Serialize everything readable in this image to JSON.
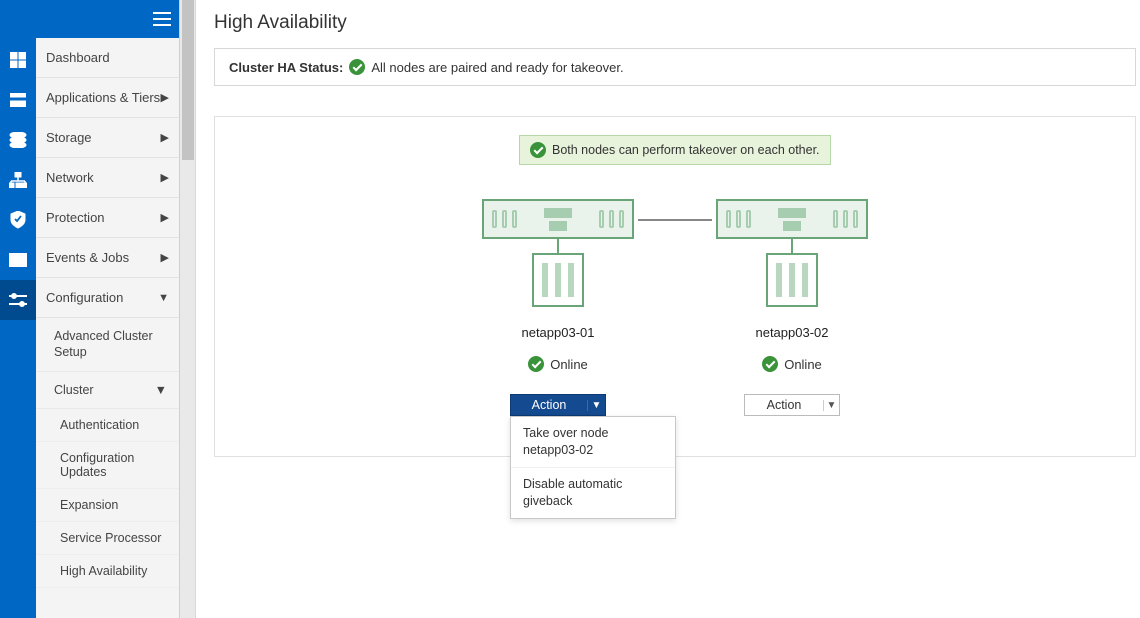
{
  "page_title": "High Availability",
  "sidebar": {
    "items": [
      {
        "label": "Dashboard",
        "expandable": false
      },
      {
        "label": "Applications & Tiers",
        "expandable": true
      },
      {
        "label": "Storage",
        "expandable": true
      },
      {
        "label": "Network",
        "expandable": true
      },
      {
        "label": "Protection",
        "expandable": true
      },
      {
        "label": "Events & Jobs",
        "expandable": true
      },
      {
        "label": "Configuration",
        "expandable": true,
        "expanded": true
      }
    ],
    "config_children": [
      {
        "label": "Advanced Cluster Setup"
      },
      {
        "label": "Cluster",
        "expanded": true
      }
    ],
    "cluster_children": [
      {
        "label": "Authentication"
      },
      {
        "label": "Configuration Updates"
      },
      {
        "label": "Expansion"
      },
      {
        "label": "Service Processor"
      },
      {
        "label": "High Availability"
      }
    ]
  },
  "ha_status": {
    "label": "Cluster HA Status:",
    "text": "All nodes are paired and ready for takeover."
  },
  "info_box": "Both nodes can perform takeover on each other.",
  "nodes": [
    {
      "name": "netapp03-01",
      "status": "Online",
      "action_label": "Action",
      "menu_open": true,
      "menu": [
        "Take over node netapp03-02",
        "Disable automatic giveback"
      ]
    },
    {
      "name": "netapp03-02",
      "status": "Online",
      "action_label": "Action",
      "menu_open": false
    }
  ]
}
